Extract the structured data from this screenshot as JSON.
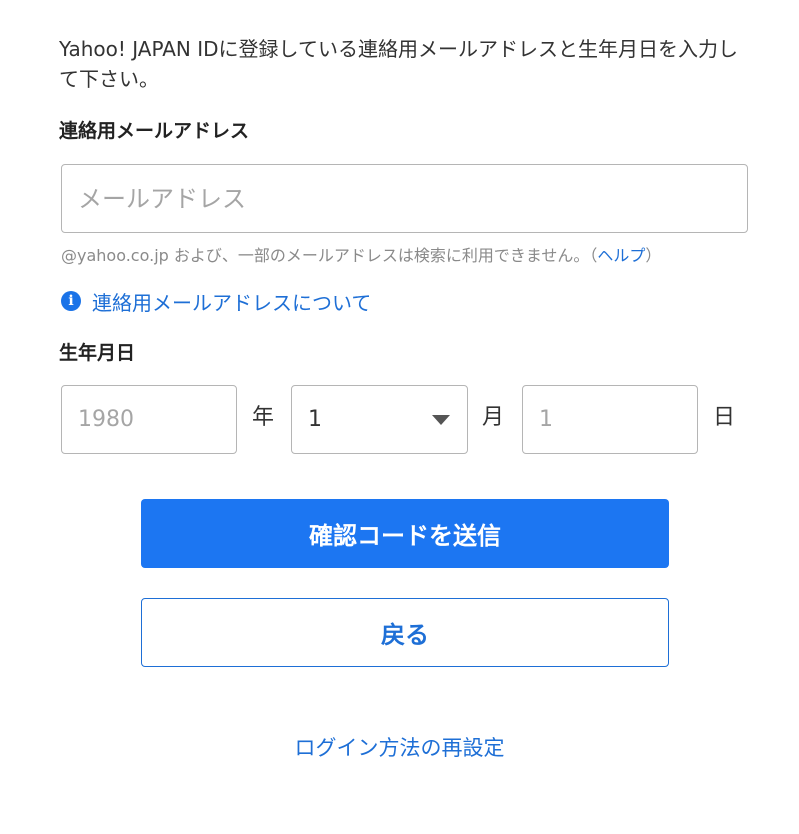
{
  "intro_text": "Yahoo! JAPAN IDに登録している連絡用メールアドレスと生年月日を入力して下さい。",
  "email": {
    "label": "連絡用メールアドレス",
    "placeholder": "メールアドレス",
    "value": "",
    "note_prefix": "@yahoo.co.jp および、一部のメールアドレスは検索に利用できません。（",
    "note_link": "ヘルプ",
    "note_suffix": "）",
    "info_icon": "info-icon",
    "info_link": "連絡用メールアドレスについて"
  },
  "birthdate": {
    "label": "生年月日",
    "year_placeholder": "1980",
    "year_unit": "年",
    "month_value": "1",
    "month_unit": "月",
    "day_placeholder": "1",
    "day_unit": "日"
  },
  "buttons": {
    "submit_label": "確認コードを送信",
    "back_label": "戻る"
  },
  "reset_link": "ログイン方法の再設定",
  "colors": {
    "primary": "#1c76f2",
    "link": "#1e6fd6",
    "text": "#333333"
  }
}
